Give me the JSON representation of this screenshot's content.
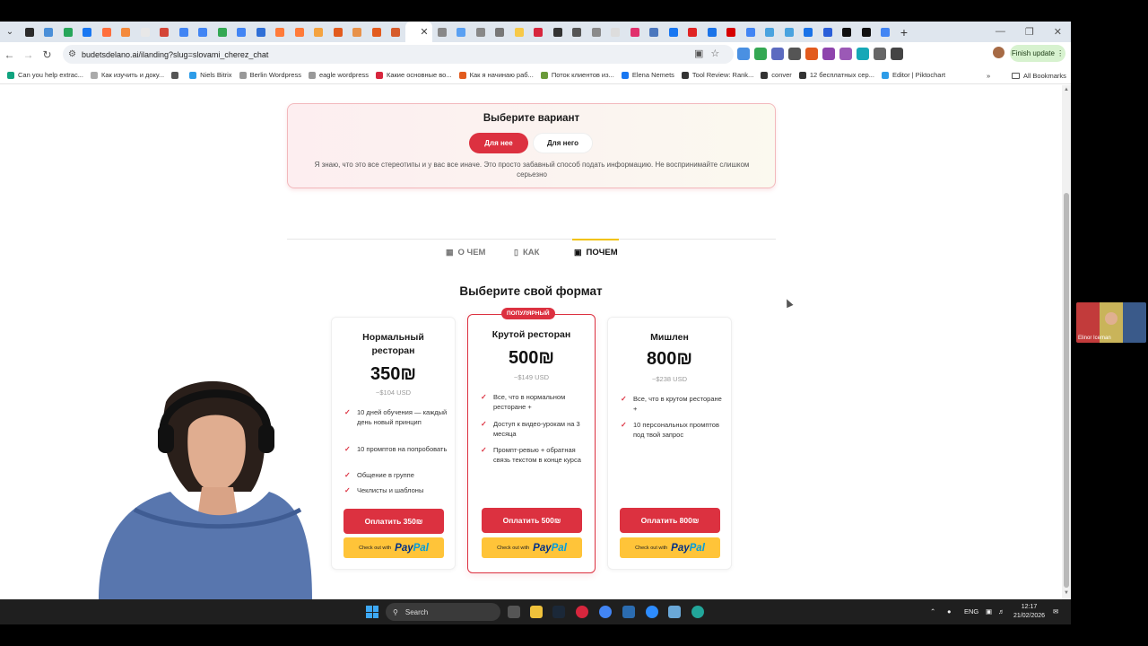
{
  "browser": {
    "url": "budetsdelano.ai/ilanding?slug=slovami_cherez_chat",
    "finish_update": "Finish update",
    "tab_colors": [
      "#2b2b2b",
      "#4a8fd8",
      "#27a65a",
      "#1877f2",
      "#ff6f3c",
      "#f48a3c",
      "#e8e8e8",
      "#d44638",
      "#4285f4",
      "#4285f4",
      "#34a853",
      "#4285f4",
      "#2f6fd6",
      "#ff7b3a",
      "#ff7b3a",
      "#f4a340",
      "#e25b1e",
      "#e8924a",
      "#e25b1e",
      "#d65b2b",
      "#ffffff",
      "#888888",
      "#5aa0f2",
      "#888888",
      "#777777",
      "#f7c948",
      "#d7263d",
      "#333333",
      "#555555",
      "#8a8a8a",
      "#dddddd",
      "#e1306c",
      "#4b77be",
      "#1877f2",
      "#e02424",
      "#1a73e8",
      "#d60000",
      "#4285f4",
      "#4aa3df",
      "#4aa3df",
      "#1a73e8",
      "#2b5fd9",
      "#111111",
      "#111111",
      "#4285f4"
    ],
    "extension_colors": [
      "#4a90e2",
      "#34a853",
      "#5c6bc0",
      "#555555",
      "#e25b1e",
      "#8e44ad",
      "#9b59b6",
      "#16a8b7",
      "#666666",
      "#444444"
    ],
    "bookmarks": [
      {
        "label": "Can you help extrac...",
        "color": "#10a37f"
      },
      {
        "label": "Как изучить и доку...",
        "color": "#aaaaaa"
      },
      {
        "label": "",
        "color": "#555555"
      },
      {
        "label": "Niels Bitrix",
        "color": "#2d9ce8"
      },
      {
        "label": "Berlin Wordpress",
        "color": "#999999"
      },
      {
        "label": "eagle wordpress",
        "color": "#999999"
      },
      {
        "label": "Какие основные во...",
        "color": "#d7263d"
      },
      {
        "label": "Как я начинаю раб...",
        "color": "#e25b1e"
      },
      {
        "label": "Поток клиентов из...",
        "color": "#6a9a3a"
      },
      {
        "label": "Elena Nemets",
        "color": "#1877f2"
      },
      {
        "label": "Tool Review: Rank...",
        "color": "#333333"
      },
      {
        "label": "conver",
        "color": "#333333"
      },
      {
        "label": "12 бесплатных сер...",
        "color": "#333333"
      },
      {
        "label": "Editor | Piktochart",
        "color": "#2d9ce8"
      }
    ],
    "all_bookmarks": "All Bookmarks"
  },
  "variant": {
    "title": "Выберите вариант",
    "option_her": "Для нее",
    "option_him": "Для него",
    "note": "Я знаю, что это все стереотипы и у вас все иначе. Это просто забавный способ подать информацию. Не воспринимайте слишком серьезно"
  },
  "nav_tabs": [
    {
      "label": "О ЧЕМ",
      "icon": "grid-icon"
    },
    {
      "label": "КАК",
      "icon": "bookmark-icon"
    },
    {
      "label": "ПОЧЕМ",
      "icon": "price-tag-icon",
      "active": true
    }
  ],
  "format_title": "Выберите свой формат",
  "plans": [
    {
      "name_line1": "Нормальный",
      "name_line2": "ресторан",
      "price": "350₪",
      "usd": "~$104 USD",
      "features": [
        "10 дней обучения — каждый день новый принцип",
        "10 промптов на попробовать",
        "Общение в группе",
        "Чеклисты и шаблоны"
      ],
      "pay_label": "Оплатить 350₪",
      "paypal_prefix": "Check out with",
      "paypal_word1": "Pay",
      "paypal_word2": "Pal"
    },
    {
      "badge": "ПОПУЛЯРНЫЙ",
      "name_line1": "Крутой ресторан",
      "price": "500₪",
      "usd": "~$149 USD",
      "features": [
        "Все, что в нормальном ресторане +",
        "Доступ к видео-урокам на 3 месяца",
        "Промпт-ревью + обратная связь текстом в конце курса"
      ],
      "pay_label": "Оплатить 500₪",
      "paypal_prefix": "Check out with",
      "paypal_word1": "Pay",
      "paypal_word2": "Pal"
    },
    {
      "name_line1": "Мишлен",
      "price": "800₪",
      "usd": "~$238 USD",
      "features": [
        "Все, что в крутом ресторане +",
        "10 персональных промптов под твой запрос"
      ],
      "pay_label": "Оплатить 800₪",
      "paypal_prefix": "Check out with",
      "paypal_word1": "Pay",
      "paypal_word2": "Pal"
    }
  ],
  "side_thumb": {
    "label": "Elinor Iceman"
  },
  "taskbar": {
    "search": "Search",
    "lang": "ENG",
    "time": "12:17",
    "date": "21/02/2026"
  }
}
